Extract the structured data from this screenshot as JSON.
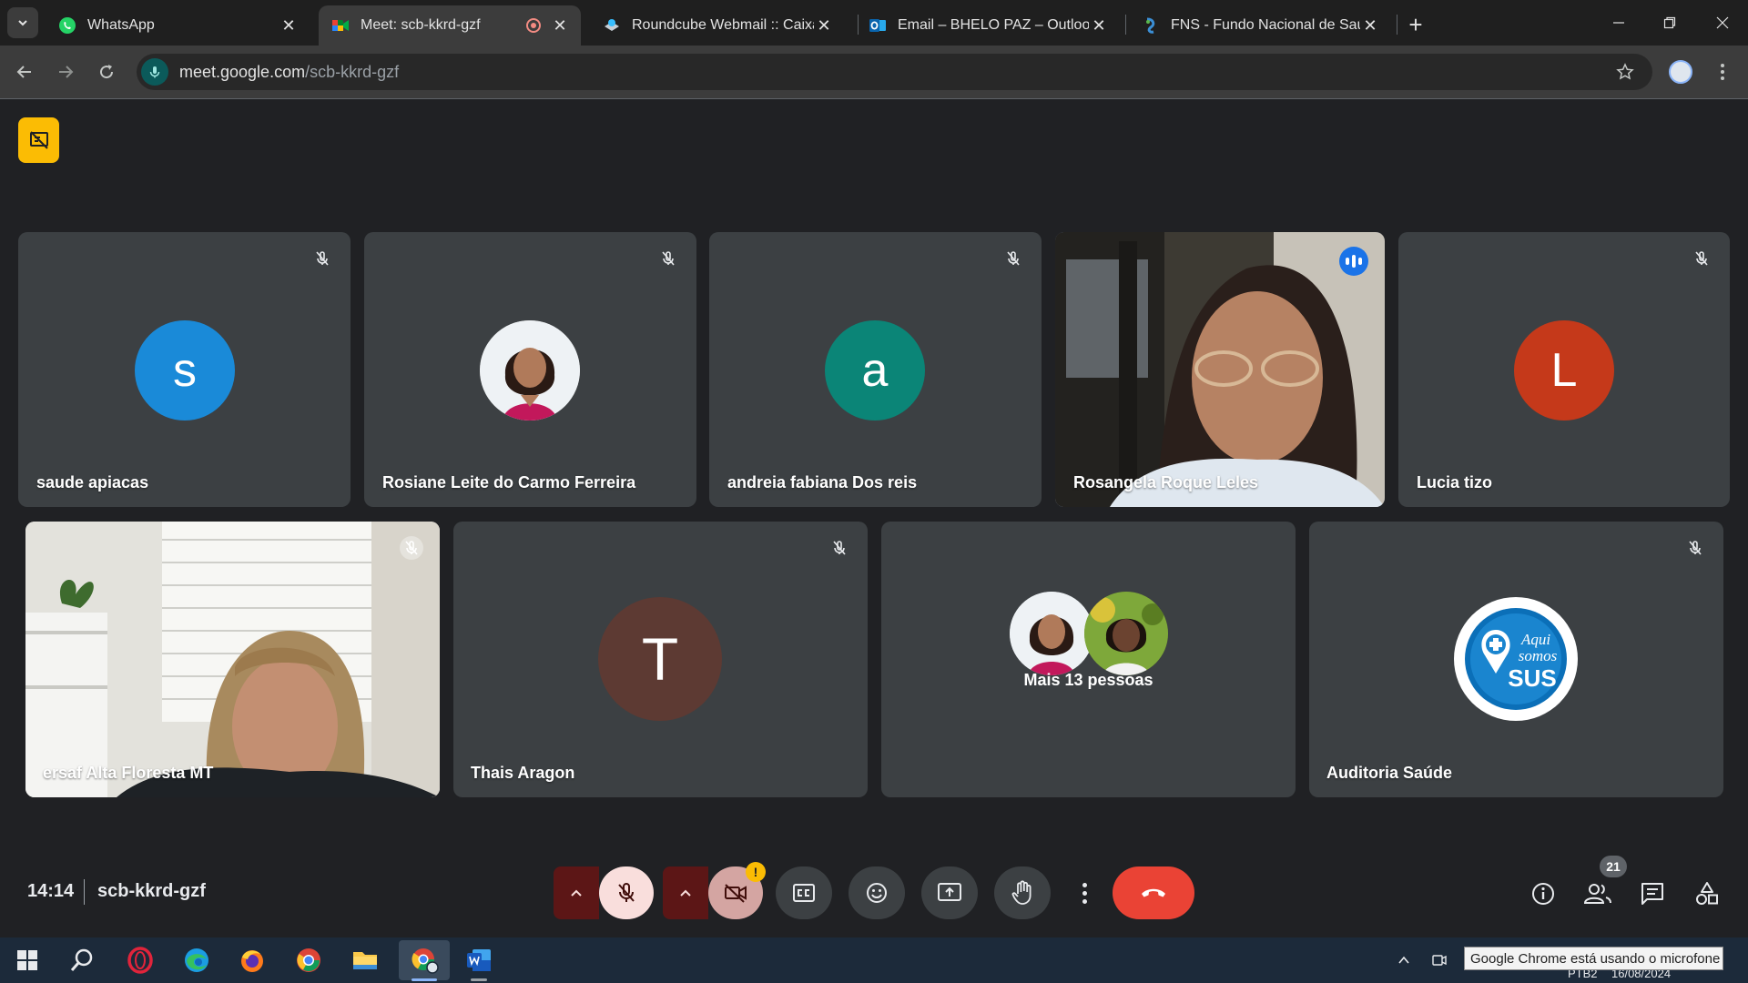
{
  "browser": {
    "tabs": [
      {
        "title": "WhatsApp",
        "icon": "whatsapp-icon",
        "active": false
      },
      {
        "title": "Meet: scb-kkrd-gzf",
        "icon": "google-meet-icon",
        "active": true
      },
      {
        "title": "Roundcube Webmail :: Caixa de",
        "icon": "roundcube-icon",
        "active": false
      },
      {
        "title": "Email – BHELO PAZ – Outlook",
        "icon": "outlook-icon",
        "active": false
      },
      {
        "title": "FNS - Fundo Nacional de Saúde",
        "icon": "fns-icon",
        "active": false
      }
    ],
    "url_host": "meet.google.com",
    "url_path": "/scb-kkrd-gzf"
  },
  "meet": {
    "participants_row1": [
      {
        "name": "saude apiacas",
        "initial": "s",
        "color": "#1a8ad8",
        "type": "initial"
      },
      {
        "name": "Rosiane Leite do Carmo Ferreira",
        "type": "photo"
      },
      {
        "name": "andreia fabiana Dos reis",
        "initial": "a",
        "color": "#0b8577",
        "type": "initial"
      },
      {
        "name": "Rosangela Roque Leles",
        "type": "video",
        "speaking": true
      },
      {
        "name": "Lucia tizo",
        "initial": "L",
        "color": "#c5391a",
        "type": "initial"
      }
    ],
    "participants_row2": [
      {
        "name": "ersaf Alta Floresta MT",
        "type": "video"
      },
      {
        "name": "Thais Aragon",
        "initial": "T",
        "color": "#5d3a33",
        "type": "initial"
      },
      {
        "name": "Mais 13 pessoas",
        "type": "group"
      },
      {
        "name": "Auditoria Saúde",
        "type": "logo",
        "logo_text_1": "Aqui",
        "logo_text_2": "somos",
        "logo_text_3": "SUS"
      }
    ],
    "time": "14:14",
    "meeting_code": "scb-kkrd-gzf",
    "people_count": "21",
    "camera_warning": "!"
  },
  "taskbar": {
    "tooltip": "Google Chrome está usando o microfone",
    "tray_lang": "PTB2",
    "tray_date": "16/08/2024"
  },
  "colors": {
    "meet_bg": "#202124",
    "tile_bg": "#3c4043",
    "hangup": "#ea4335",
    "speaking_outline": "#8ab4f8",
    "badge_yellow": "#fbbc04"
  }
}
